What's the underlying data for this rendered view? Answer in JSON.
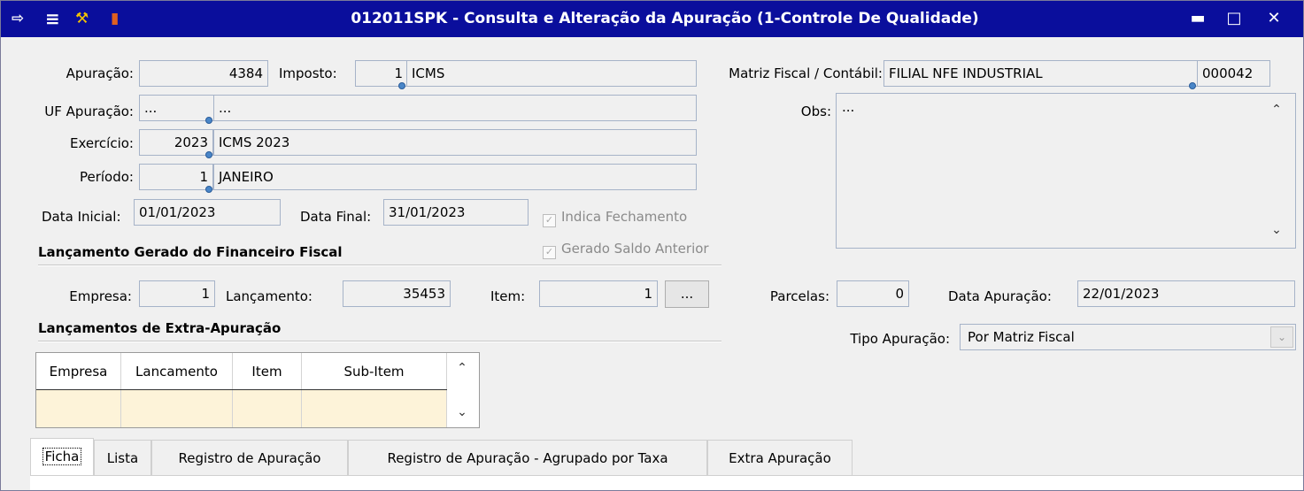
{
  "window": {
    "title": "012011SPK - Consulta e Alteração da Apuração (1-Controle De Qualidade)"
  },
  "fields": {
    "apuracao_label": "Apuração:",
    "apuracao_value": "4384",
    "imposto_label": "Imposto:",
    "imposto_code": "1",
    "imposto_name": "ICMS",
    "matriz_label": "Matriz Fiscal / Contábil:",
    "matriz_name": "FILIAL NFE INDUSTRIAL",
    "matriz_code": "000042",
    "uf_label": "UF Apuração:",
    "uf_code": "...",
    "uf_name": "...",
    "obs_label": "Obs:",
    "obs_value": "...",
    "exercicio_label": "Exercício:",
    "exercicio_code": "2023",
    "exercicio_name": "ICMS 2023",
    "periodo_label": "Período:",
    "periodo_code": "1",
    "periodo_name": "JANEIRO",
    "data_inicial_label": "Data Inicial:",
    "data_inicial_value": "01/01/2023",
    "data_final_label": "Data Final:",
    "data_final_value": "31/01/2023",
    "indica_fechamento_label": "Indica Fechamento",
    "gerado_saldo_label": "Gerado Saldo Anterior"
  },
  "lancamento_section": {
    "title": "Lançamento Gerado do Financeiro Fiscal",
    "empresa_label": "Empresa:",
    "empresa_value": "1",
    "lancamento_label": "Lançamento:",
    "lancamento_value": "35453",
    "item_label": "Item:",
    "item_value": "1",
    "more_button": "...",
    "parcelas_label": "Parcelas:",
    "parcelas_value": "0",
    "data_apuracao_label": "Data Apuração:",
    "data_apuracao_value": "22/01/2023"
  },
  "extra_section": {
    "title": "Lançamentos de Extra-Apuração",
    "tipo_label": "Tipo Apuração:",
    "tipo_value": "Por Matriz Fiscal",
    "columns": [
      "Empresa",
      "Lancamento",
      "Item",
      "Sub-Item"
    ]
  },
  "tabs": [
    {
      "label": "Ficha"
    },
    {
      "label": "Lista"
    },
    {
      "label": "Registro de Apuração"
    },
    {
      "label": "Registro de Apuração - Agrupado por Taxa"
    },
    {
      "label": "Extra Apuração"
    }
  ],
  "colors": {
    "titlebar": "#0a0e9c",
    "grid_row": "#fdf3d9"
  }
}
